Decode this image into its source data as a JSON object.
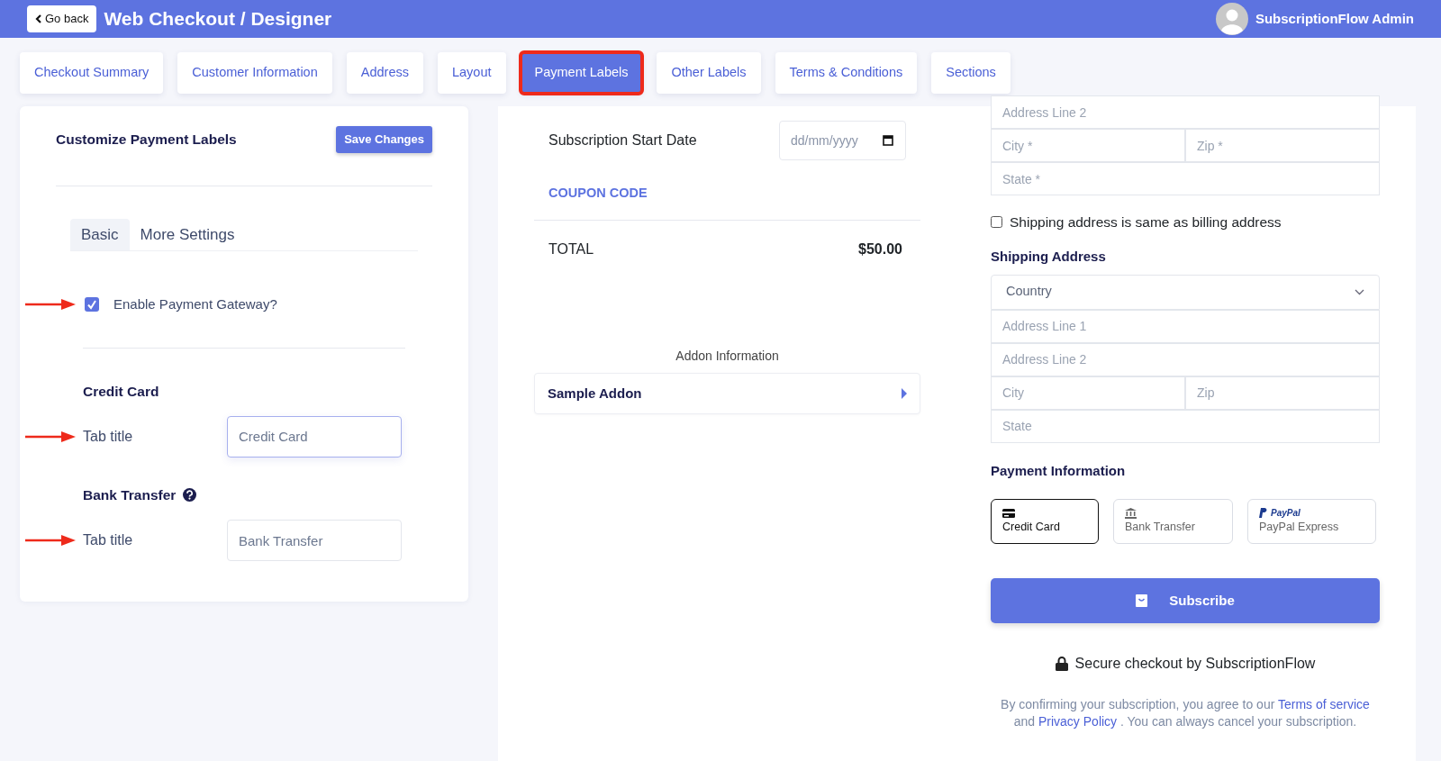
{
  "header": {
    "back_button": "Go back",
    "title": "Web Checkout / Designer",
    "user": "SubscriptionFlow Admin"
  },
  "tabs": [
    {
      "label": "Checkout Summary",
      "selected": false
    },
    {
      "label": "Customer Information",
      "selected": false
    },
    {
      "label": "Address",
      "selected": false
    },
    {
      "label": "Layout",
      "selected": false
    },
    {
      "label": "Payment Labels",
      "selected": true
    },
    {
      "label": "Other Labels",
      "selected": false
    },
    {
      "label": "Terms & Conditions",
      "selected": false
    },
    {
      "label": "Sections",
      "selected": false
    }
  ],
  "settings": {
    "title": "Customize Payment Labels",
    "save_button": "Save Changes",
    "subtabs": [
      {
        "label": "Basic",
        "selected": true
      },
      {
        "label": "More Settings",
        "selected": false
      }
    ],
    "gateway": {
      "label": "Enable Payment Gateway?",
      "checked": true,
      "marked": true
    },
    "sections": [
      {
        "heading": "Credit Card",
        "help": false,
        "field_label": "Tab title",
        "value": "Credit Card",
        "focused": true,
        "marked": true
      },
      {
        "heading": "Bank Transfer",
        "help": true,
        "field_label": "Tab title",
        "value": "Bank Transfer",
        "focused": false,
        "marked": true
      }
    ]
  },
  "summary": {
    "start_date": {
      "label": "Subscription Start Date",
      "placeholder": "dd/mm/yyyy"
    },
    "coupon": "COUPON CODE",
    "total": {
      "label": "TOTAL",
      "amount": "$50.00"
    },
    "addon_heading": "Addon Information",
    "addons": [
      {
        "name": "Sample Addon"
      }
    ]
  },
  "billing": {
    "rows": [
      {
        "fields": [
          {
            "placeholder": "Address Line 2"
          }
        ]
      },
      {
        "fields": [
          {
            "placeholder": "City *"
          },
          {
            "placeholder": "Zip *"
          }
        ]
      },
      {
        "fields": [
          {
            "placeholder": "State *"
          }
        ]
      }
    ]
  },
  "same_address": {
    "label": "Shipping address is same as billing address",
    "checked": false
  },
  "shipping": {
    "heading": "Shipping Address",
    "country": "Country",
    "rows": [
      {
        "fields": [
          {
            "placeholder": "Address Line 1"
          }
        ]
      },
      {
        "fields": [
          {
            "placeholder": "Address Line 2"
          }
        ]
      },
      {
        "fields": [
          {
            "placeholder": "City"
          },
          {
            "placeholder": "Zip"
          }
        ]
      },
      {
        "fields": [
          {
            "placeholder": "State"
          }
        ]
      }
    ]
  },
  "payment": {
    "heading": "Payment Information",
    "methods": [
      {
        "kind": "card",
        "label": "Credit Card",
        "selected": true
      },
      {
        "kind": "bank",
        "label": "Bank Transfer",
        "selected": false
      },
      {
        "kind": "paypal",
        "brand": "PayPal",
        "label": "PayPal Express",
        "selected": false
      }
    ]
  },
  "subscribe_button": "Subscribe",
  "secure_note": "Secure checkout by SubscriptionFlow",
  "terms": [
    {
      "kind": "text",
      "text": "By confirming your subscription, you agree to our"
    },
    {
      "kind": "link",
      "text": "Terms of service"
    },
    {
      "kind": "text",
      "text": "and"
    },
    {
      "kind": "link",
      "text": "Privacy Policy"
    },
    {
      "kind": "text",
      "text": ". You can always cancel your subscription."
    }
  ]
}
